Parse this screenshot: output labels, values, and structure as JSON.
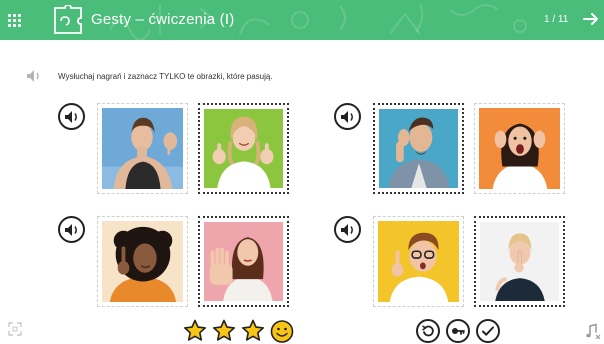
{
  "header": {
    "title": "Gesty – ćwiczenia (I)",
    "counter": "1 / 11",
    "menu_icon": "grid-icon",
    "logo_icon": "puzzle-icon",
    "next_icon": "arrow-right-icon"
  },
  "instruction": {
    "text": "Wysłuchaj nagrań i zaznacz TYLKO te obrazki, które pasują.",
    "icon": "speaker-icon"
  },
  "questions": [
    {
      "id": "q1",
      "sound_icon": "speaker-icon",
      "cards": [
        {
          "id": "q1-a",
          "subject": "woman thumbs down",
          "selected": false
        },
        {
          "id": "q1-b",
          "subject": "girl thumbs up",
          "selected": true
        }
      ]
    },
    {
      "id": "q2",
      "sound_icon": "speaker-icon",
      "cards": [
        {
          "id": "q2-a",
          "subject": "man hand behind ear",
          "selected": true
        },
        {
          "id": "q2-b",
          "subject": "surprised woman",
          "selected": false
        }
      ]
    },
    {
      "id": "q3",
      "sound_icon": "speaker-icon",
      "cards": [
        {
          "id": "q3-a",
          "subject": "woman finger up",
          "selected": false
        },
        {
          "id": "q3-b",
          "subject": "woman stop palm",
          "selected": true
        }
      ]
    },
    {
      "id": "q4",
      "sound_icon": "speaker-icon",
      "cards": [
        {
          "id": "q4-a",
          "subject": "boy finger up",
          "selected": false
        },
        {
          "id": "q4-b",
          "subject": "girl shh gesture",
          "selected": true
        }
      ]
    }
  ],
  "footer": {
    "stars_filled": 3,
    "stars_total": 3,
    "controls": [
      "restart-icon",
      "hint-icon",
      "check-icon"
    ]
  },
  "colors": {
    "header": "#4bbd7a",
    "star_fill": "#f9c515",
    "star_stroke": "#222222"
  }
}
